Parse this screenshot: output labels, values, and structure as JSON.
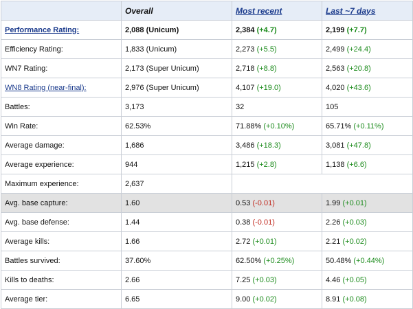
{
  "header": {
    "corner": "",
    "overall": "Overall",
    "most_recent": "Most recent",
    "last_7_days": "Last ~7 days"
  },
  "rows": [
    {
      "label": "Performance Rating:",
      "overall": "2,088 (Unicum)",
      "recent": "2,384",
      "recent_delta": "(+4.7)",
      "recent_delta_sign": "pos",
      "week": "2,199",
      "week_delta": "(+7.7)",
      "week_delta_sign": "pos"
    },
    {
      "label": "Efficiency Rating:",
      "overall": "1,833 (Unicum)",
      "recent": "2,273",
      "recent_delta": "(+5.5)",
      "recent_delta_sign": "pos",
      "week": "2,499",
      "week_delta": "(+24.4)",
      "week_delta_sign": "pos"
    },
    {
      "label": "WN7 Rating:",
      "overall": "2,173 (Super Unicum)",
      "recent": "2,718",
      "recent_delta": "(+8.8)",
      "recent_delta_sign": "pos",
      "week": "2,563",
      "week_delta": "(+20.8)",
      "week_delta_sign": "pos"
    },
    {
      "label": "WN8 Rating (near-final):",
      "overall": "2,976 (Super Unicum)",
      "recent": "4,107",
      "recent_delta": "(+19.0)",
      "recent_delta_sign": "pos",
      "week": "4,020",
      "week_delta": "(+43.6)",
      "week_delta_sign": "pos"
    },
    {
      "label": "Battles:",
      "overall": "3,173",
      "recent": "32",
      "recent_delta": "",
      "recent_delta_sign": "pos",
      "week": "105",
      "week_delta": "",
      "week_delta_sign": "pos"
    },
    {
      "label": "Win Rate:",
      "overall": "62.53%",
      "recent": "71.88%",
      "recent_delta": "(+0.10%)",
      "recent_delta_sign": "pos",
      "week": "65.71%",
      "week_delta": "(+0.11%)",
      "week_delta_sign": "pos"
    },
    {
      "label": "Average damage:",
      "overall": "1,686",
      "recent": "3,486",
      "recent_delta": "(+18.3)",
      "recent_delta_sign": "pos",
      "week": "3,081",
      "week_delta": "(+47.8)",
      "week_delta_sign": "pos"
    },
    {
      "label": "Average experience:",
      "overall": "944",
      "recent": "1,215",
      "recent_delta": "(+2.8)",
      "recent_delta_sign": "pos",
      "week": "1,138",
      "week_delta": "(+6.6)",
      "week_delta_sign": "pos"
    },
    {
      "label": "Maximum experience:",
      "overall": "2,637",
      "recent": "",
      "recent_delta": "",
      "recent_delta_sign": "pos",
      "week": "",
      "week_delta": "",
      "week_delta_sign": "pos"
    },
    {
      "label": "Avg. base capture:",
      "overall": "1.60",
      "recent": "0.53",
      "recent_delta": "(-0.01)",
      "recent_delta_sign": "neg",
      "week": "1.99",
      "week_delta": "(+0.01)",
      "week_delta_sign": "pos"
    },
    {
      "label": "Avg. base defense:",
      "overall": "1.44",
      "recent": "0.38",
      "recent_delta": "(-0.01)",
      "recent_delta_sign": "neg",
      "week": "2.26",
      "week_delta": "(+0.03)",
      "week_delta_sign": "pos"
    },
    {
      "label": "Average kills:",
      "overall": "1.66",
      "recent": "2.72",
      "recent_delta": "(+0.01)",
      "recent_delta_sign": "pos",
      "week": "2.21",
      "week_delta": "(+0.02)",
      "week_delta_sign": "pos"
    },
    {
      "label": "Battles survived:",
      "overall": "37.60%",
      "recent": "62.50%",
      "recent_delta": "(+0.25%)",
      "recent_delta_sign": "pos",
      "week": "50.48%",
      "week_delta": "(+0.44%)",
      "week_delta_sign": "pos"
    },
    {
      "label": "Kills to deaths:",
      "overall": "2.66",
      "recent": "7.25",
      "recent_delta": "(+0.03)",
      "recent_delta_sign": "pos",
      "week": "4.46",
      "week_delta": "(+0.05)",
      "week_delta_sign": "pos"
    },
    {
      "label": "Average tier:",
      "overall": "6.65",
      "recent": "9.00",
      "recent_delta": "(+0.02)",
      "recent_delta_sign": "pos",
      "week": "8.91",
      "week_delta": "(+0.08)",
      "week_delta_sign": "pos"
    }
  ],
  "colors": {
    "positive": "#1a8a1a",
    "negative": "#c0281e",
    "link": "#1a3a8c",
    "header_bg": "#e6edf7",
    "shaded_row_bg": "#e2e2e2",
    "border": "#c9ced6"
  }
}
